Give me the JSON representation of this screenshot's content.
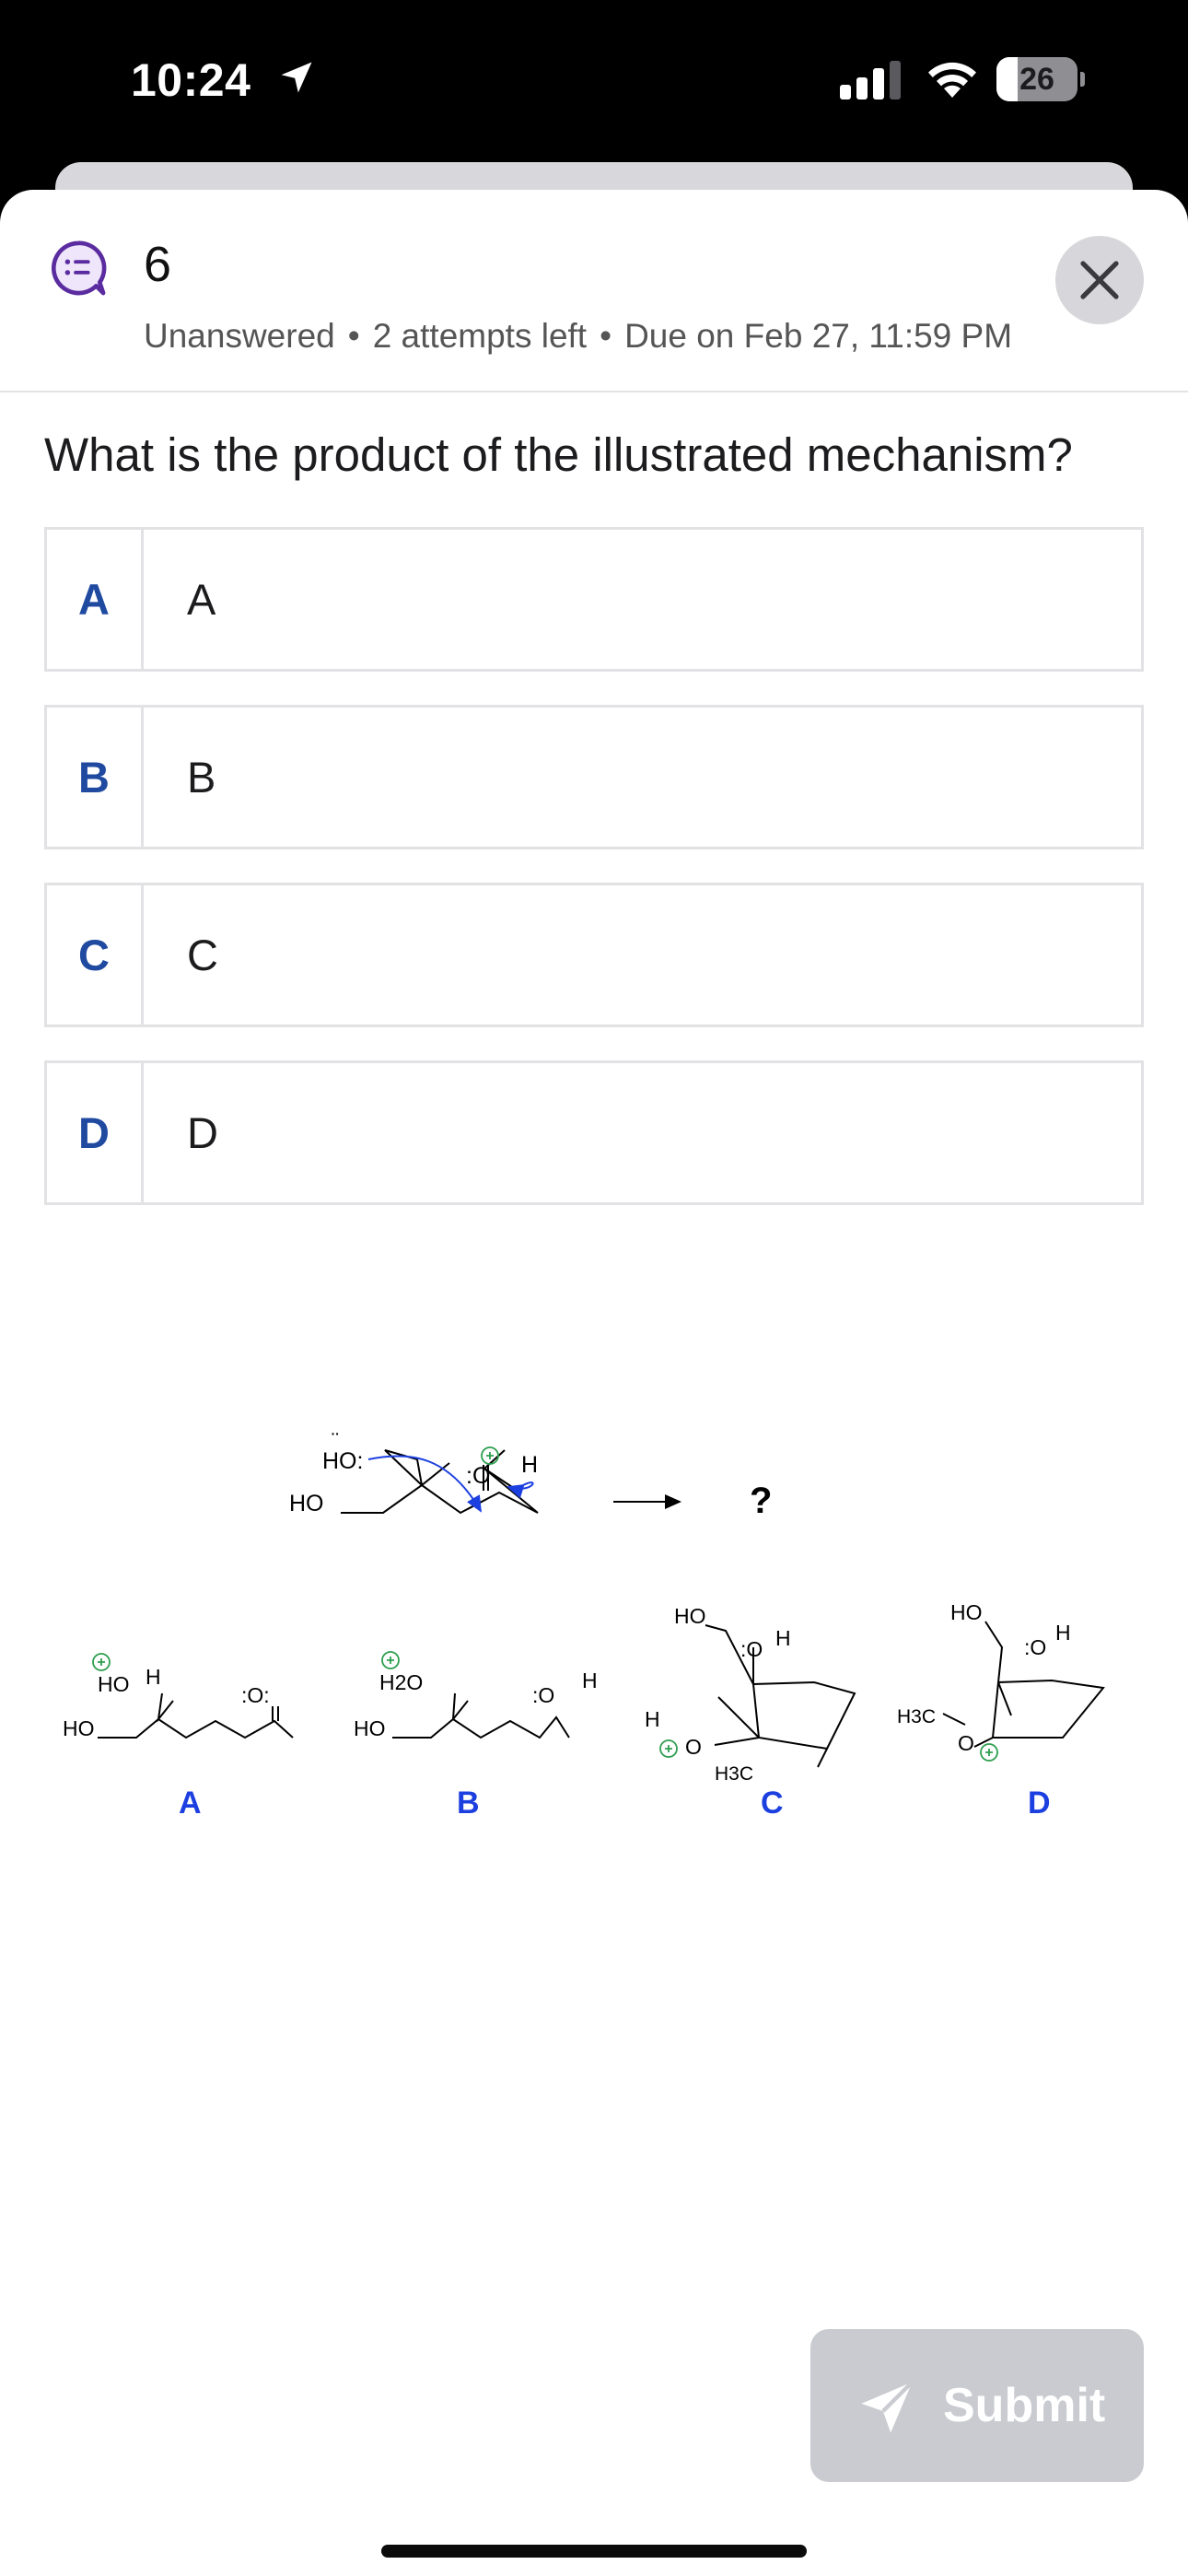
{
  "status_bar": {
    "time": "10:24",
    "battery_level": "26",
    "battery_fraction": 0.26,
    "icons": [
      "location-arrow-icon",
      "cellular-signal-icon",
      "wifi-icon",
      "battery-icon"
    ]
  },
  "header": {
    "question_number": "6",
    "status": "Unanswered",
    "attempts": "2 attempts left",
    "due": "Due on Feb 27, 11:59 PM",
    "icons": [
      "question-list-icon",
      "close-icon"
    ]
  },
  "question": {
    "prompt": "What is the product of the illustrated mechanism?"
  },
  "options": [
    {
      "letter": "A",
      "label": "A"
    },
    {
      "letter": "B",
      "label": "B"
    },
    {
      "letter": "C",
      "label": "C"
    },
    {
      "letter": "D",
      "label": "D"
    }
  ],
  "figure": {
    "reactant_labels": [
      "HO:",
      "HO",
      ":O",
      "H"
    ],
    "product_marker": "?",
    "choice_labels": [
      "A",
      "B",
      "C",
      "D"
    ],
    "structure_text": {
      "a": [
        "HO",
        "H",
        "HO",
        ":O:"
      ],
      "b": [
        "H2O",
        "HO",
        ":O",
        "H"
      ],
      "c": [
        "HO",
        ":O",
        "H",
        "H",
        "O",
        "H3C"
      ],
      "d": [
        "HO",
        ":O",
        "H",
        "H3C",
        "O"
      ]
    },
    "accent_color": "#1c3fe0",
    "plus_color": "#2e9e4f"
  },
  "submit": {
    "label": "Submit",
    "icon": "send-icon"
  }
}
